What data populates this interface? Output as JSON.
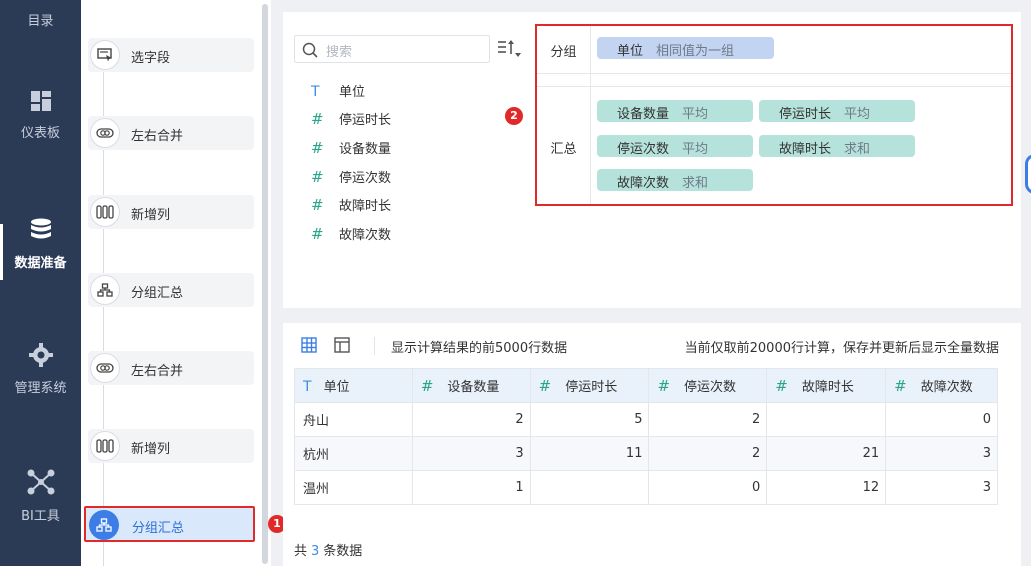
{
  "nav": {
    "top_label": "目录",
    "items": [
      {
        "label": "仪表板",
        "icon": "dashboard-icon"
      },
      {
        "label": "数据准备",
        "icon": "database-icon",
        "active": true
      },
      {
        "label": "管理系统",
        "icon": "gear-icon"
      },
      {
        "label": "BI工具",
        "icon": "network-icon"
      }
    ]
  },
  "steps": [
    {
      "label": "选字段",
      "icon": "select-field-icon"
    },
    {
      "label": "左右合并",
      "icon": "merge-icon"
    },
    {
      "label": "新增列",
      "icon": "add-column-icon"
    },
    {
      "label": "分组汇总",
      "icon": "group-summary-icon"
    },
    {
      "label": "左右合并",
      "icon": "merge-icon"
    },
    {
      "label": "新增列",
      "icon": "add-column-icon"
    },
    {
      "label": "分组汇总",
      "icon": "group-summary-icon",
      "selected": true
    }
  ],
  "badges": {
    "one": "1",
    "two": "2"
  },
  "config": {
    "search_placeholder": "搜索",
    "fields": [
      {
        "type": "T",
        "name": "单位"
      },
      {
        "type": "#",
        "name": "停运时长"
      },
      {
        "type": "#",
        "name": "设备数量"
      },
      {
        "type": "#",
        "name": "停运次数"
      },
      {
        "type": "#",
        "name": "故障时长"
      },
      {
        "type": "#",
        "name": "故障次数"
      }
    ],
    "group_label": "分组",
    "group_chip": {
      "name": "单位",
      "agg": "相同值为一组"
    },
    "summary_label": "汇总",
    "summary_chips": [
      {
        "name": "设备数量",
        "agg": "平均"
      },
      {
        "name": "停运时长",
        "agg": "平均"
      },
      {
        "name": "停运次数",
        "agg": "平均"
      },
      {
        "name": "故障时长",
        "agg": "求和"
      },
      {
        "name": "故障次数",
        "agg": "求和"
      }
    ]
  },
  "data_panel": {
    "info_left": "显示计算结果的前5000行数据",
    "info_right": "当前仅取前20000行计算，保存并更新后显示全量数据",
    "columns": [
      {
        "type": "T",
        "name": "单位"
      },
      {
        "type": "#",
        "name": "设备数量"
      },
      {
        "type": "#",
        "name": "停运时长"
      },
      {
        "type": "#",
        "name": "停运次数"
      },
      {
        "type": "#",
        "name": "故障时长"
      },
      {
        "type": "#",
        "name": "故障次数"
      }
    ],
    "rows": [
      [
        "舟山",
        "2",
        "5",
        "2",
        "",
        "0"
      ],
      [
        "杭州",
        "3",
        "11",
        "2",
        "21",
        "3"
      ],
      [
        "温州",
        "1",
        "",
        "0",
        "12",
        "3"
      ]
    ],
    "total_prefix": "共",
    "total_count": "3",
    "total_suffix": "条数据"
  },
  "colors": {
    "nav_bg": "#2b3a55",
    "accent": "#3d7ee6",
    "highlight": "#e02a2a",
    "chip_green": "#b5e2da",
    "chip_blue": "#c3d4f2"
  }
}
